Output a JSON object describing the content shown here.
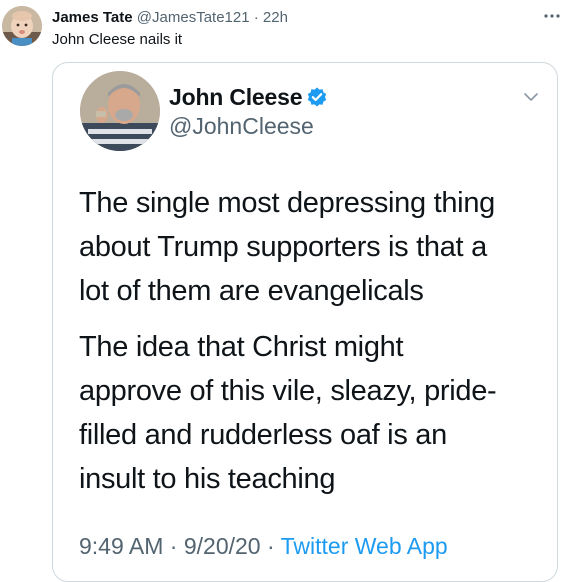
{
  "tweet": {
    "author_name": "James Tate",
    "author_handle": "@JamesTate121",
    "separator": "·",
    "time": "22h",
    "text": "John Cleese nails it"
  },
  "quoted": {
    "author_name": "John Cleese",
    "author_handle": "@JohnCleese",
    "body": [
      [
        "The single most depressing thing",
        "about Trump supporters is that a",
        "lot of them are evangelicals"
      ],
      [
        "The idea that Christ might",
        "approve of this vile, sleazy, pride-",
        "filled and rudderless oaf is an",
        "insult to his teaching"
      ]
    ],
    "time": "9:49 AM",
    "separator": "·",
    "date": "9/20/20",
    "source": "Twitter Web App"
  },
  "icons": {
    "more": "more-horizontal-icon",
    "verified": "verified-badge-icon",
    "chevron": "chevron-down-icon"
  },
  "colors": {
    "accent": "#1d9bf0",
    "secondary_text": "#536471",
    "border": "#cfd9de"
  }
}
